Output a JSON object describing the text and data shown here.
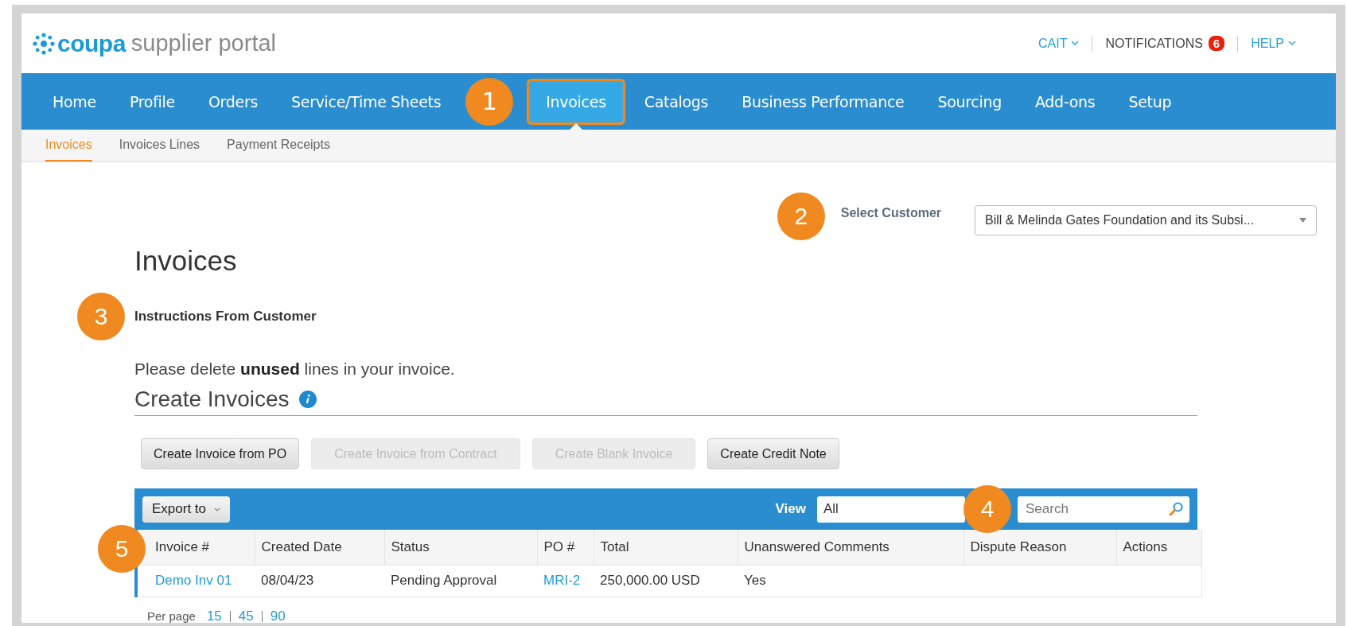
{
  "logo": {
    "brand": "coupa",
    "product": "supplier portal"
  },
  "top_links": [
    {
      "label": "CAIT",
      "kind": "dropdown"
    },
    {
      "label": "NOTIFICATIONS",
      "kind": "badge",
      "badge": "6"
    },
    {
      "label": "HELP",
      "kind": "dropdown"
    }
  ],
  "nav": [
    {
      "label": "Home",
      "selected": false
    },
    {
      "label": "Profile",
      "selected": false
    },
    {
      "label": "Orders",
      "selected": false
    },
    {
      "label": "Service/Time Sheets",
      "selected": false
    },
    {
      "label": "Invoices",
      "selected": true,
      "callout": "1",
      "outlined": true
    },
    {
      "label": "Catalogs",
      "selected": false
    },
    {
      "label": "Business Performance",
      "selected": false
    },
    {
      "label": "Sourcing",
      "selected": false
    },
    {
      "label": "Add-ons",
      "selected": false
    },
    {
      "label": "Setup",
      "selected": false
    }
  ],
  "subnav": [
    {
      "label": "Invoices",
      "selected": true
    },
    {
      "label": "Invoices Lines",
      "selected": false
    },
    {
      "label": "Payment Receipts",
      "selected": false
    }
  ],
  "customer_select": {
    "callout": "2",
    "label": "Select Customer",
    "value": "Bill & Melinda Gates Foundation and its Subsi..."
  },
  "title": "Invoices",
  "instructions": {
    "callout": "3",
    "heading": "Instructions From Customer",
    "text": "Please delete **unused** lines in your invoice."
  },
  "create": {
    "title": "Create Invoices",
    "buttons": [
      {
        "label": "Create Invoice from PO",
        "disabled": false
      },
      {
        "label": "Create Invoice from Contract",
        "disabled": true
      },
      {
        "label": "Create Blank Invoice",
        "disabled": true
      },
      {
        "label": "Create Credit Note",
        "disabled": false
      }
    ]
  },
  "toolbar": {
    "export": "Export to",
    "view_label": "View",
    "view_value": "All",
    "callout": "4",
    "search_placeholder": "Search"
  },
  "table": {
    "callout": "5",
    "columns": [
      "Invoice #",
      "Created Date",
      "Status",
      "PO #",
      "Total",
      "Unanswered Comments",
      "Dispute Reason",
      "Actions"
    ],
    "rows": [
      {
        "cells": [
          {
            "text": "Demo Inv 01",
            "kind": "link"
          },
          {
            "text": "08/04/23",
            "kind": "text"
          },
          {
            "text": "Pending Approval",
            "kind": "text"
          },
          {
            "text": "MRI-2",
            "kind": "link"
          },
          {
            "text": "250,000.00 USD",
            "kind": "text"
          },
          {
            "text": "Yes",
            "kind": "text"
          },
          {
            "text": "",
            "kind": "text"
          },
          {
            "text": "",
            "kind": "text"
          }
        ]
      }
    ]
  },
  "pagination": {
    "label": "Per page",
    "options": [
      "15",
      "45",
      "90"
    ]
  }
}
